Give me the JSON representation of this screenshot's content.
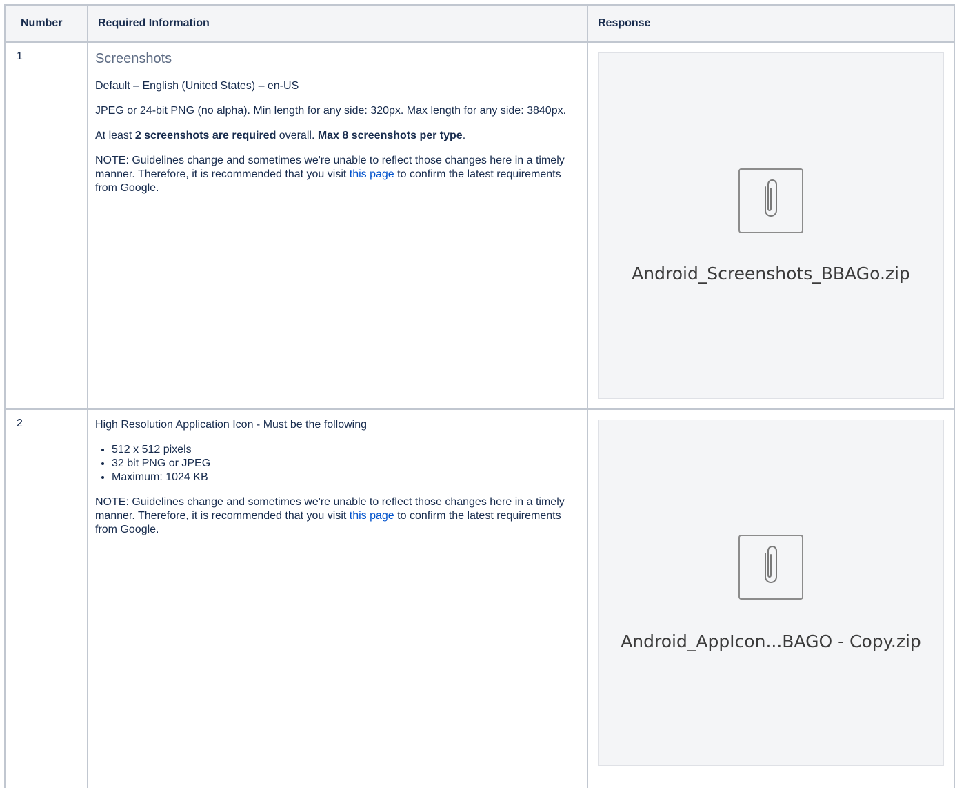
{
  "headers": {
    "number": "Number",
    "required": "Required Information",
    "response": "Response"
  },
  "row1": {
    "number": "1",
    "heading": "Screenshots",
    "p1": "Default – English (United States) – en-US",
    "p2": "JPEG or 24-bit PNG (no alpha). Min length for any side: 320px. Max length for any side: 3840px.",
    "p3_a": "At least ",
    "p3_b": "2 screenshots are required",
    "p3_c": " overall. ",
    "p3_d": "Max 8 screenshots per type",
    "p3_e": ".",
    "note_a": "NOTE:  Guidelines change and sometimes we're unable to reflect those changes here in a timely manner.  Therefore, it is recommended that you visit ",
    "note_link": "this page",
    "note_b": " to confirm the latest requirements from Google.",
    "attachment": "Android_Screenshots_BBAGo.zip"
  },
  "row2": {
    "number": "2",
    "intro": "High Resolution Application Icon - Must be the following",
    "bullets": [
      "512 x 512 pixels",
      "32 bit PNG or JPEG",
      "Maximum: 1024 KB"
    ],
    "note_a": "NOTE:  Guidelines change and sometimes we're unable to reflect those changes here in a timely manner.  Therefore, it is recommended that you visit ",
    "note_link": "this page",
    "note_b": " to confirm the latest requirements from Google.",
    "attachment": "Android_AppIcon...BAGO - Copy.zip"
  },
  "icons": {
    "attachment": "paperclip-icon"
  }
}
